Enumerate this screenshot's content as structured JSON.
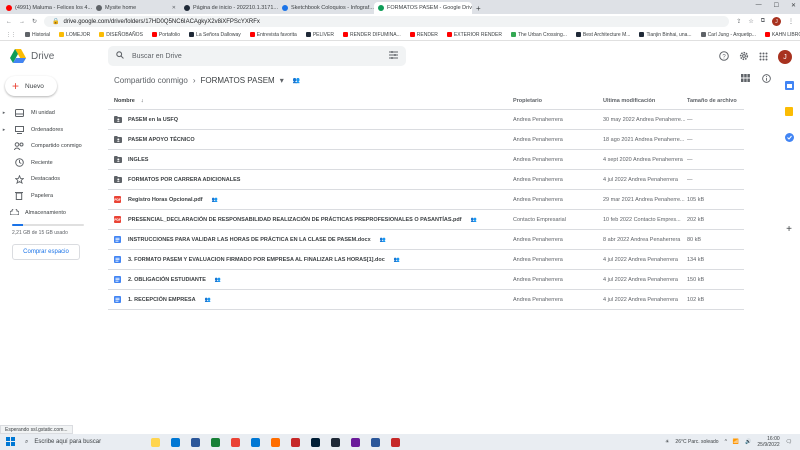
{
  "browser": {
    "tabs": [
      {
        "title": "(4991) Maluma - Felices los 4...",
        "color": "#ff0000",
        "active": false
      },
      {
        "title": "Mysite home",
        "color": "#5f6368",
        "active": false
      },
      {
        "title": "Página de inicio - 202210.1.3171...",
        "color": "#1f2937",
        "active": false
      },
      {
        "title": "Sketchbook Coloquios - Infograf...",
        "color": "#1a73e8",
        "active": false
      },
      {
        "title": "FORMATOS PASEM - Google Drive",
        "color": "#0f9d58",
        "active": true
      }
    ],
    "new_tab": "+",
    "url": "drive.google.com/drive/folders/17HD0Q5NC6IACAgkyX2v8iXFPScYXRFx",
    "profile_initial": "J",
    "bookmarks": [
      {
        "label": "Historial",
        "color": "#5f6368"
      },
      {
        "label": "LOMEJOR",
        "color": "#fbbc04"
      },
      {
        "label": "DISEÑOBAÑOS",
        "color": "#fbbc04"
      },
      {
        "label": "Portafolio",
        "color": "#ff0000"
      },
      {
        "label": "La Señora Dalloway",
        "color": "#1f2937"
      },
      {
        "label": "Entrevista favorita",
        "color": "#ff0000"
      },
      {
        "label": "PELIVER",
        "color": "#1f2937"
      },
      {
        "label": "RENDER DIFUMINA...",
        "color": "#ff0000"
      },
      {
        "label": "RENDER",
        "color": "#ff0000"
      },
      {
        "label": "EXTERIOR RENDER",
        "color": "#ff0000"
      },
      {
        "label": "The Urban Crossing...",
        "color": "#34a853"
      },
      {
        "label": "Best Architecture M...",
        "color": "#1f2937"
      },
      {
        "label": "Tianjin Binhai, una...",
        "color": "#1f2937"
      },
      {
        "label": "Carl Jung - Arquetip...",
        "color": "#5f6368"
      },
      {
        "label": "KAHN LIBRO",
        "color": "#ff0000"
      }
    ]
  },
  "drive": {
    "logo_text": "Drive",
    "search_placeholder": "Buscar en Drive",
    "user_initial": "J",
    "new_button": "Nuevo",
    "nav": [
      {
        "label": "Mi unidad",
        "icon": "my-drive-icon",
        "caret": true
      },
      {
        "label": "Ordenadores",
        "icon": "computer-icon",
        "caret": true
      },
      {
        "label": "Compartido conmigo",
        "icon": "shared-with-me-icon",
        "caret": false
      },
      {
        "label": "Reciente",
        "icon": "clock-icon",
        "caret": false
      },
      {
        "label": "Destacados",
        "icon": "star-icon",
        "caret": false
      },
      {
        "label": "Papelera",
        "icon": "trash-icon",
        "caret": false
      }
    ],
    "storage": {
      "label": "Almacenamiento",
      "used_text": "2,21 GB de 15 GB usado",
      "used_fraction": 0.147,
      "buy_label": "Comprar espacio"
    },
    "breadcrumb": {
      "parent": "Compartido conmigo",
      "separator": "›",
      "current": "FORMATOS PASEM"
    },
    "columns": {
      "name": "Nombre",
      "owner": "Propietario",
      "modified": "Última modificación",
      "size": "Tamaño de archivo"
    },
    "files": [
      {
        "name": "PASEM en la USFQ",
        "type": "folder",
        "shared": false,
        "owner": "Andrea Penaherrera",
        "modified": "30 may 2022 Andrea Penaherre...",
        "size": "—"
      },
      {
        "name": "PASEM APOYO TÉCNICO",
        "type": "folder",
        "shared": false,
        "owner": "Andrea Penaherrera",
        "modified": "18 ago 2021 Andrea Penaherre...",
        "size": "—"
      },
      {
        "name": "INGLES",
        "type": "folder",
        "shared": false,
        "owner": "Andrea Penaherrera",
        "modified": "4 sept 2020 Andrea Penaherrera",
        "size": "—"
      },
      {
        "name": "FORMATOS POR CARRERA ADICIONALES",
        "type": "folder",
        "shared": false,
        "owner": "Andrea Penaherrera",
        "modified": "4 jul 2022 Andrea Penaherrera",
        "size": "—"
      },
      {
        "name": "Registro Horas Opcional.pdf",
        "type": "pdf",
        "shared": true,
        "owner": "Andrea Penaherrera",
        "modified": "29 mar 2021 Andrea Penaherre...",
        "size": "105 kB"
      },
      {
        "name": "PRESENCIAL_DECLARACIÓN DE RESPONSABILIDAD REALIZACIÓN DE PRÁCTICAS PREPROFESIONALES O PASANTÍAS.pdf",
        "type": "pdf",
        "shared": true,
        "owner": "Contacto Empresarial",
        "modified": "10 feb 2022 Contacto Empres...",
        "size": "202 kB"
      },
      {
        "name": "INSTRUCCIONES PARA VALIDAR LAS HORAS DE PRÁCTICA EN LA CLASE DE PASEM.docx",
        "type": "doc",
        "shared": true,
        "owner": "Andrea Penaherrera",
        "modified": "8 abr 2022 Andrea Penaherrera",
        "size": "80 kB"
      },
      {
        "name": "3. FORMATO PASEM Y EVALUACION FIRMADO POR EMPRESA AL FINALIZAR LAS HORAS[1].doc",
        "type": "doc",
        "shared": true,
        "owner": "Andrea Penaherrera",
        "modified": "4 jul 2022 Andrea Penaherrera",
        "size": "134 kB"
      },
      {
        "name": "2. OBLIGACIÓN ESTUDIANTE",
        "type": "doc",
        "shared": true,
        "owner": "Andrea Penaherrera",
        "modified": "4 jul 2022 Andrea Penaherrera",
        "size": "150 kB"
      },
      {
        "name": "1.  RECEPCIÓN EMPRESA",
        "type": "doc",
        "shared": true,
        "owner": "Andrea Penaherrera",
        "modified": "4 jul 2022 Andrea Penaherrera",
        "size": "102 kB"
      }
    ]
  },
  "status_bar": "Esperando ssl.gstatic.com...",
  "taskbar": {
    "search_placeholder": "Escribe aquí para buscar",
    "apps": [
      "#ffd54f",
      "#0078d4",
      "#2b579a",
      "#188038",
      "#ea4335",
      "#0078d4",
      "#ff6d00",
      "#c62828",
      "#001e36",
      "#1f2937",
      "#6a1b9a",
      "#2b579a",
      "#c62828"
    ],
    "weather": "26°C  Parc. soleado",
    "time": "16:00",
    "date": "25/9/2022"
  }
}
